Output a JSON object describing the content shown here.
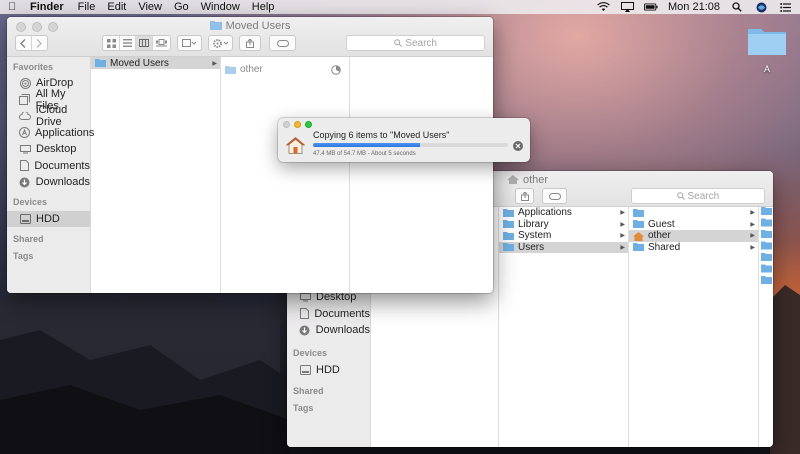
{
  "menubar": {
    "app_name": "Finder",
    "items": [
      "File",
      "Edit",
      "View",
      "Go",
      "Window",
      "Help"
    ],
    "clock": "Mon 21:08"
  },
  "desktop": {
    "disk_label": "A"
  },
  "front_window": {
    "title": "Moved Users",
    "search_placeholder": "Search",
    "sidebar": {
      "favorites_label": "Favorites",
      "favorites": [
        "AirDrop",
        "All My Files",
        "iCloud Drive",
        "Applications",
        "Desktop",
        "Documents",
        "Downloads"
      ],
      "devices_label": "Devices",
      "devices": [
        "HDD"
      ],
      "shared_label": "Shared",
      "tags_label": "Tags"
    },
    "columns": {
      "col1": [
        "Moved Users"
      ],
      "col2": [
        "other"
      ]
    }
  },
  "back_window": {
    "title": "other",
    "search_placeholder": "Search",
    "sidebar": {
      "items": [
        "Desktop",
        "Documents",
        "Downloads"
      ],
      "devices_label": "Devices",
      "devices": [
        "HDD"
      ],
      "shared_label": "Shared",
      "tags_label": "Tags"
    },
    "columns": {
      "col1": [
        "Applications",
        "Library",
        "System",
        "Users"
      ],
      "col2": [
        "",
        "Guest",
        "other",
        "Shared"
      ]
    }
  },
  "copy_dialog": {
    "message": "Copying 6 items to \"Moved Users\"",
    "progress": 0.55,
    "detail": "47.4 MB of 54.7 MB - About 5 seconds"
  },
  "colors": {
    "folder": "#6fb0e4",
    "progress": "#2f77dc",
    "selection": "#d4d4d4"
  }
}
